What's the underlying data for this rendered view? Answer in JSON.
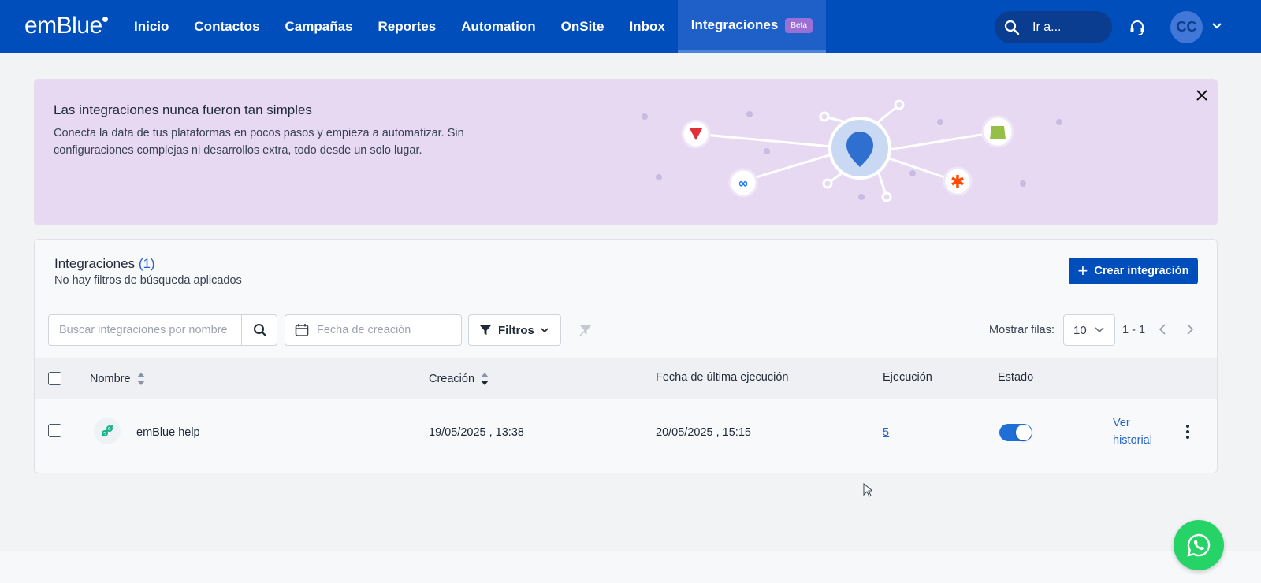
{
  "brand": {
    "logo_text": "emBlue"
  },
  "nav": {
    "items": [
      {
        "label": "Inicio"
      },
      {
        "label": "Contactos"
      },
      {
        "label": "Campañas"
      },
      {
        "label": "Reportes"
      },
      {
        "label": "Automation"
      },
      {
        "label": "OnSite"
      },
      {
        "label": "Inbox"
      },
      {
        "label": "Integraciones",
        "badge": "Beta",
        "active": true
      }
    ],
    "search_label": "Ir a...",
    "avatar_initials": "CC"
  },
  "banner": {
    "title": "Las integraciones nunca fueron tan simples",
    "text": "Conecta la data de tus plataformas en pocos pasos y empieza a automatizar. Sin configuraciones complejas ni desarrollos extra, todo desde un solo lugar.",
    "accent_color": "#e8d9f3"
  },
  "card": {
    "title": "Integraciones",
    "count": "(1)",
    "subtitle": "No hay filtros de búsqueda aplicados",
    "create_button": "Crear integración"
  },
  "toolbar": {
    "search_placeholder": "Buscar integraciones por nombre",
    "date_placeholder": "Fecha de creación",
    "filters_label": "Filtros",
    "rows_label": "Mostrar filas:",
    "rows_value": "10",
    "range": "1 - 1"
  },
  "table": {
    "columns": {
      "name": "Nombre",
      "created": "Creación",
      "last_run": "Fecha de última ejecución",
      "executions": "Ejecución",
      "status": "Estado"
    },
    "rows": [
      {
        "name": "emBlue help",
        "created": "19/05/2025 , 13:38",
        "last_run": "20/05/2025 , 15:15",
        "executions": "5",
        "status_on": true,
        "history_link": "Ver historial"
      }
    ]
  },
  "colors": {
    "primary": "#004dbc",
    "link": "#2563c9",
    "whatsapp": "#25d366"
  }
}
